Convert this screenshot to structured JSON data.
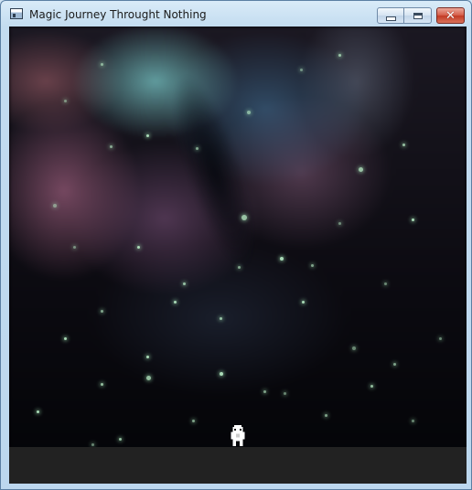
{
  "window": {
    "title": "Magic Journey Throught Nothing",
    "icon": "app-window-icon",
    "controls": {
      "minimize_icon": "minimize-icon",
      "maximize_icon": "maximize-icon",
      "close_icon": "close-icon",
      "close_glyph": "✕"
    }
  },
  "scene": {
    "background": "nebula-starfield",
    "ground_color": "#222222",
    "player_sprite": "robot-icon",
    "accent_colors": {
      "nebula_teal": "#78c8c8",
      "nebula_pink": "#96607a",
      "star_green": "#b9efc6"
    }
  }
}
